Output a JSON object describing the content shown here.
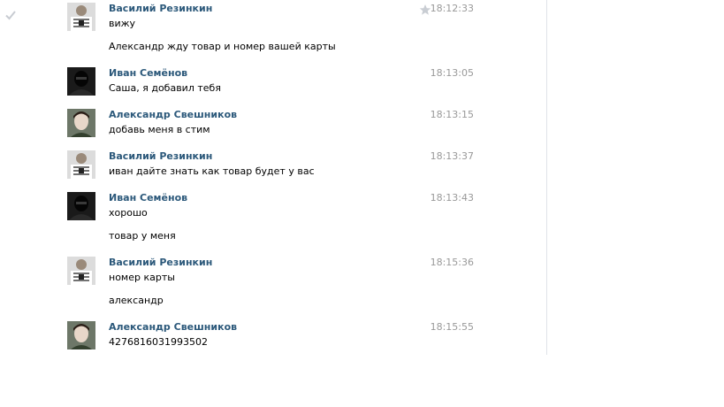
{
  "messages": [
    {
      "author": "Василий Резинкин",
      "avatar": "avatar-vasily",
      "time": "18:12:33",
      "starred_icon": "star-icon",
      "lines": [
        "вижу",
        "Александр жду товар и номер вашей карты"
      ]
    },
    {
      "author": "Иван Семёнов",
      "avatar": "avatar-ivan",
      "time": "18:13:05",
      "lines": [
        "Саша, я добавил тебя"
      ]
    },
    {
      "author": "Александр Свешников",
      "avatar": "avatar-alexander",
      "time": "18:13:15",
      "lines": [
        "добавь меня в стим"
      ]
    },
    {
      "author": "Василий Резинкин",
      "avatar": "avatar-vasily",
      "time": "18:13:37",
      "lines": [
        "иван дайте знать как товар будет у вас"
      ]
    },
    {
      "author": "Иван Семёнов",
      "avatar": "avatar-ivan",
      "time": "18:13:43",
      "lines": [
        "хорошо",
        "товар у меня"
      ]
    },
    {
      "author": "Василий Резинкин",
      "avatar": "avatar-vasily",
      "time": "18:15:36",
      "lines": [
        "номер карты",
        "александр"
      ]
    },
    {
      "author": "Александр Свешников",
      "avatar": "avatar-alexander",
      "time": "18:15:55",
      "lines": [
        "4276816031993502"
      ]
    }
  ],
  "colors": {
    "author_link": "#2b587a",
    "timestamp": "#999999",
    "message_text": "#000000"
  }
}
